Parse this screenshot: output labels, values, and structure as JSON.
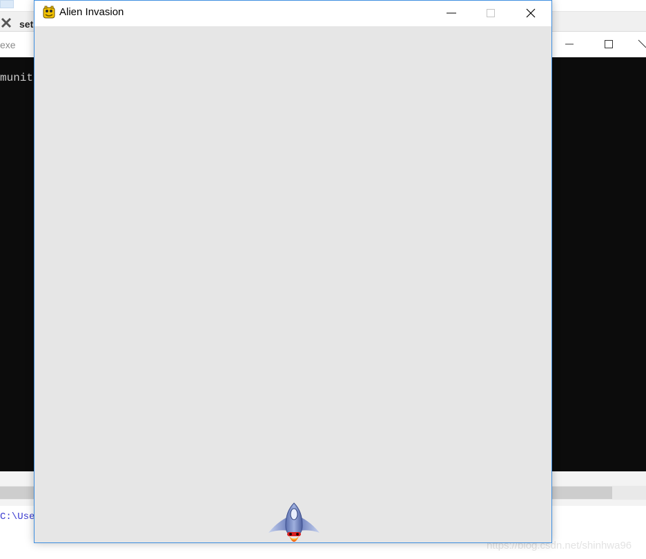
{
  "background_editor": {
    "tab_label": "set",
    "console_title": "exe",
    "console_output": "munit",
    "prompt_text": "C:\\Use",
    "watermark": "https://blog.csdn.net/shinhwa96"
  },
  "game_window": {
    "title": "Alien Invasion",
    "background_color": "#e6e6e6",
    "icons": {
      "app": "pygame-snake-icon",
      "minimize": "minimize-icon",
      "maximize": "maximize-icon",
      "close": "close-icon",
      "ship": "rocket-ship"
    }
  }
}
